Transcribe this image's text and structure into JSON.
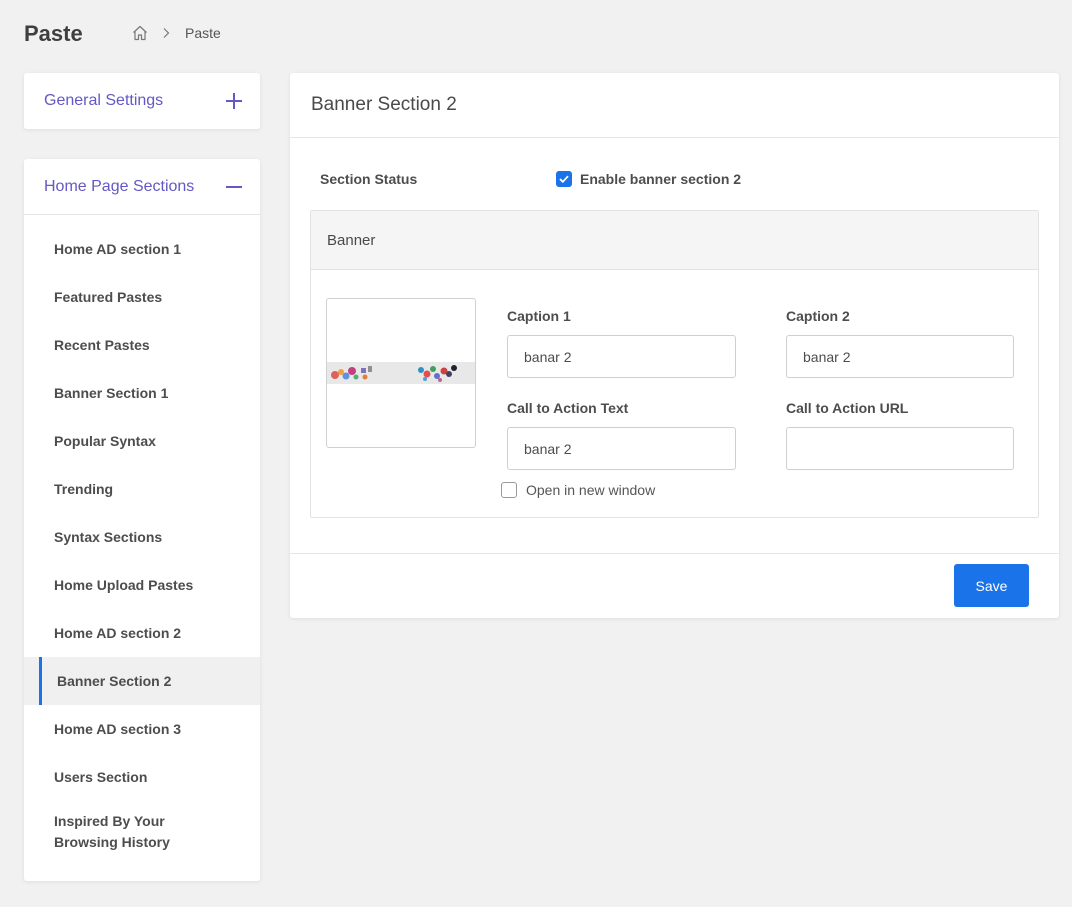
{
  "header": {
    "title": "Paste",
    "breadcrumb": {
      "current": "Paste"
    }
  },
  "sidebar": {
    "general": {
      "label": "General Settings"
    },
    "home_sections": {
      "label": "Home Page Sections",
      "items": [
        {
          "label": "Home AD section 1"
        },
        {
          "label": "Featured Pastes"
        },
        {
          "label": "Recent Pastes"
        },
        {
          "label": "Banner Section 1"
        },
        {
          "label": "Popular Syntax"
        },
        {
          "label": "Trending"
        },
        {
          "label": "Syntax Sections"
        },
        {
          "label": "Home Upload Pastes"
        },
        {
          "label": "Home AD section 2"
        },
        {
          "label": "Banner Section 2",
          "active": true
        },
        {
          "label": "Home AD section 3"
        },
        {
          "label": "Users Section"
        },
        {
          "label": "Inspired By Your Browsing History"
        }
      ]
    }
  },
  "main": {
    "title": "Banner Section 2",
    "section_status": {
      "label": "Section Status",
      "checkbox_label": "Enable banner section 2",
      "checked": true
    },
    "banner": {
      "panel_title": "Banner",
      "caption1": {
        "label": "Caption 1",
        "value": "banar 2"
      },
      "caption2": {
        "label": "Caption 2",
        "value": "banar 2"
      },
      "cta_text": {
        "label": "Call to Action Text",
        "value": "banar 2"
      },
      "cta_url": {
        "label": "Call to Action URL",
        "value": ""
      },
      "new_window": {
        "label": "Open in new window",
        "checked": false
      }
    },
    "save_label": "Save"
  },
  "colors": {
    "accent": "#6358c4",
    "primary": "#1a73e8",
    "background": "#f1f1f1"
  }
}
